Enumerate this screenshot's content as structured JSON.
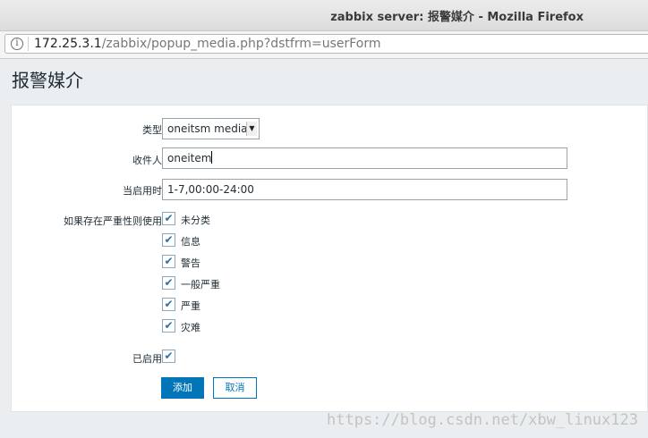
{
  "window": {
    "title": "zabbix server: 报警媒介 - Mozilla Firefox"
  },
  "urlbar": {
    "host": "172.25.3.1",
    "path": "/zabbix/popup_media.php?dstfrm=userForm"
  },
  "page": {
    "title": "报警媒介"
  },
  "form": {
    "type_label": "类型",
    "type_value": "oneitsm media",
    "sendto_label": "收件人",
    "sendto_value": "oneitem",
    "period_label": "当启用时",
    "period_value": "1-7,00:00-24:00",
    "severity_label": "如果存在严重性则使用",
    "severities": [
      {
        "label": "未分类",
        "checked": true
      },
      {
        "label": "信息",
        "checked": true
      },
      {
        "label": "警告",
        "checked": true
      },
      {
        "label": "一般严重",
        "checked": true
      },
      {
        "label": "严重",
        "checked": true
      },
      {
        "label": "灾难",
        "checked": true
      }
    ],
    "enabled_label": "已启用",
    "enabled_checked": true,
    "add_button": "添加",
    "cancel_button": "取消"
  },
  "watermark": "https://blog.csdn.net/xbw_linux123",
  "colors": {
    "primary": "#0275b8",
    "check": "#2a71a6",
    "background": "#ebeef0"
  }
}
